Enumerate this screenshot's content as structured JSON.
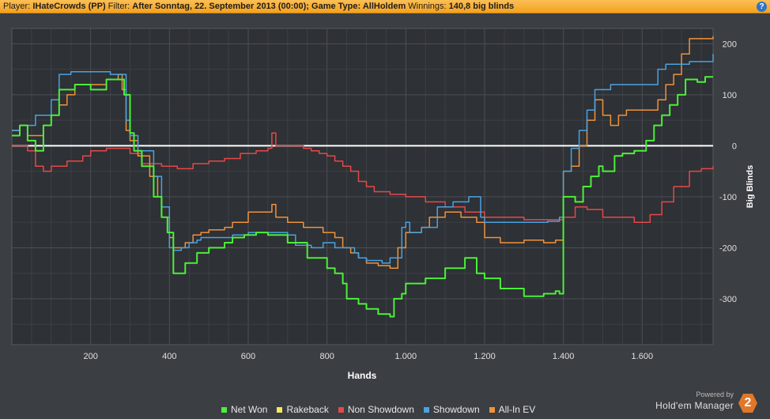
{
  "header": {
    "player_label": "Player:",
    "player_value": "IHateCrowds (PP)",
    "filter_label": "Filter:",
    "filter_value": "After Sonntag, 22. September 2013 (00:00); Game Type: AllHoldem",
    "winnings_label": "Winnings:",
    "winnings_value": "140,8 big blinds",
    "help_icon": "?"
  },
  "branding": {
    "powered": "Powered by",
    "name": "Hold'em Manager",
    "logo": "2"
  },
  "chart_data": {
    "type": "line",
    "xlabel": "Hands",
    "ylabel": "Big Blinds",
    "xlim": [
      0,
      1780
    ],
    "ylim": [
      -390,
      230
    ],
    "xticks": [
      200,
      400,
      600,
      800,
      1000,
      1200,
      1400,
      1600
    ],
    "xtick_labels": [
      "200",
      "400",
      "600",
      "800",
      "1.000",
      "1.200",
      "1.400",
      "1.600"
    ],
    "yticks": [
      200,
      100,
      0,
      -100,
      -200,
      -300
    ],
    "ytick_labels": [
      "200",
      "100",
      "0",
      "-100",
      "-200",
      "-300"
    ],
    "grid": true,
    "legend_position": "bottom",
    "series": [
      {
        "name": "Net Won",
        "color": "#4cef3b",
        "x": [
          0,
          20,
          40,
          60,
          80,
          100,
          120,
          160,
          200,
          240,
          270,
          285,
          300,
          310,
          330,
          360,
          380,
          395,
          410,
          440,
          470,
          500,
          540,
          560,
          590,
          620,
          650,
          700,
          750,
          800,
          820,
          840,
          850,
          880,
          900,
          930,
          960,
          970,
          990,
          1000,
          1050,
          1100,
          1150,
          1180,
          1200,
          1240,
          1300,
          1350,
          1380,
          1390,
          1395,
          1400,
          1430,
          1450,
          1470,
          1490,
          1500,
          1530,
          1550,
          1580,
          1610,
          1630,
          1650,
          1670,
          1690,
          1710,
          1740,
          1760,
          1780
        ],
        "values": [
          20,
          40,
          10,
          -10,
          40,
          60,
          110,
          120,
          110,
          130,
          130,
          100,
          25,
          -10,
          -40,
          -100,
          -140,
          -170,
          -250,
          -230,
          -210,
          -200,
          -190,
          -180,
          -175,
          -170,
          -175,
          -190,
          -220,
          -240,
          -250,
          -270,
          -300,
          -310,
          -320,
          -330,
          -335,
          -300,
          -290,
          -270,
          -260,
          -240,
          -220,
          -250,
          -260,
          -280,
          -295,
          -290,
          -285,
          -290,
          -290,
          -100,
          -110,
          -80,
          -60,
          -40,
          -50,
          -20,
          -15,
          -10,
          10,
          40,
          60,
          80,
          100,
          130,
          125,
          135,
          135
        ]
      },
      {
        "name": "Rakeback",
        "color": "#f6e85b",
        "x": [
          0,
          1780
        ],
        "values": [
          0,
          0
        ]
      },
      {
        "name": "Non Showdown",
        "color": "#e5484a",
        "x": [
          0,
          40,
          60,
          80,
          100,
          140,
          180,
          200,
          240,
          270,
          300,
          330,
          380,
          420,
          460,
          500,
          540,
          580,
          620,
          650,
          660,
          670,
          700,
          740,
          760,
          780,
          800,
          820,
          840,
          860,
          880,
          900,
          920,
          960,
          1000,
          1050,
          1100,
          1150,
          1200,
          1250,
          1300,
          1350,
          1400,
          1430,
          1460,
          1500,
          1540,
          1580,
          1620,
          1650,
          1680,
          1720,
          1750,
          1780
        ],
        "values": [
          0,
          -10,
          -40,
          -50,
          -40,
          -30,
          -20,
          -10,
          -5,
          -5,
          -15,
          -35,
          -40,
          -45,
          -35,
          -30,
          -25,
          -15,
          -10,
          -5,
          25,
          0,
          0,
          -5,
          -10,
          -15,
          -20,
          -30,
          -40,
          -50,
          -70,
          -80,
          -90,
          -95,
          -100,
          -110,
          -120,
          -130,
          -140,
          -140,
          -145,
          -145,
          -140,
          -120,
          -125,
          -140,
          -140,
          -150,
          -135,
          -110,
          -80,
          -50,
          -45,
          -40
        ]
      },
      {
        "name": "Showdown",
        "color": "#4aa2e2",
        "x": [
          0,
          20,
          40,
          60,
          80,
          100,
          120,
          150,
          190,
          250,
          280,
          290,
          300,
          320,
          360,
          380,
          400,
          410,
          430,
          450,
          470,
          480,
          560,
          600,
          650,
          700,
          720,
          760,
          790,
          820,
          840,
          870,
          880,
          900,
          940,
          960,
          990,
          1000,
          1010,
          1040,
          1080,
          1120,
          1160,
          1190,
          1200,
          1240,
          1300,
          1360,
          1390,
          1400,
          1420,
          1440,
          1460,
          1480,
          1520,
          1560,
          1600,
          1640,
          1660,
          1680,
          1720,
          1780
        ],
        "values": [
          30,
          40,
          40,
          60,
          60,
          90,
          140,
          145,
          145,
          140,
          140,
          50,
          20,
          -10,
          -60,
          -120,
          -200,
          -205,
          -200,
          -190,
          -185,
          -180,
          -175,
          -170,
          -170,
          -175,
          -195,
          -200,
          -190,
          -200,
          -200,
          -210,
          -220,
          -225,
          -230,
          -220,
          -160,
          -150,
          -170,
          -160,
          -120,
          -110,
          -100,
          -140,
          -150,
          -150,
          -150,
          -148,
          -140,
          -50,
          -5,
          30,
          70,
          110,
          120,
          120,
          120,
          150,
          160,
          160,
          165,
          180
        ]
      },
      {
        "name": "All-In EV",
        "color": "#f0923b",
        "x": [
          0,
          20,
          40,
          80,
          100,
          120,
          140,
          160,
          200,
          240,
          270,
          280,
          290,
          300,
          320,
          350,
          370,
          380,
          400,
          410,
          440,
          460,
          480,
          500,
          540,
          560,
          600,
          640,
          660,
          670,
          700,
          740,
          760,
          790,
          820,
          840,
          860,
          880,
          900,
          930,
          960,
          980,
          1000,
          1040,
          1060,
          1100,
          1140,
          1180,
          1200,
          1240,
          1300,
          1350,
          1380,
          1400,
          1420,
          1440,
          1460,
          1480,
          1500,
          1520,
          1540,
          1560,
          1600,
          1640,
          1660,
          1680,
          1700,
          1720,
          1760,
          1780
        ],
        "values": [
          30,
          40,
          20,
          40,
          60,
          80,
          100,
          120,
          120,
          130,
          140,
          110,
          30,
          10,
          -20,
          -60,
          -100,
          -140,
          -180,
          -200,
          -190,
          -175,
          -170,
          -165,
          -160,
          -150,
          -130,
          -130,
          -115,
          -140,
          -150,
          -160,
          -160,
          -170,
          -180,
          -200,
          -210,
          -220,
          -230,
          -235,
          -240,
          -200,
          -170,
          -160,
          -140,
          -130,
          -140,
          -150,
          -180,
          -190,
          -185,
          -190,
          -185,
          -50,
          -40,
          0,
          50,
          90,
          60,
          40,
          60,
          70,
          70,
          90,
          120,
          140,
          180,
          210,
          210,
          215
        ]
      }
    ]
  }
}
